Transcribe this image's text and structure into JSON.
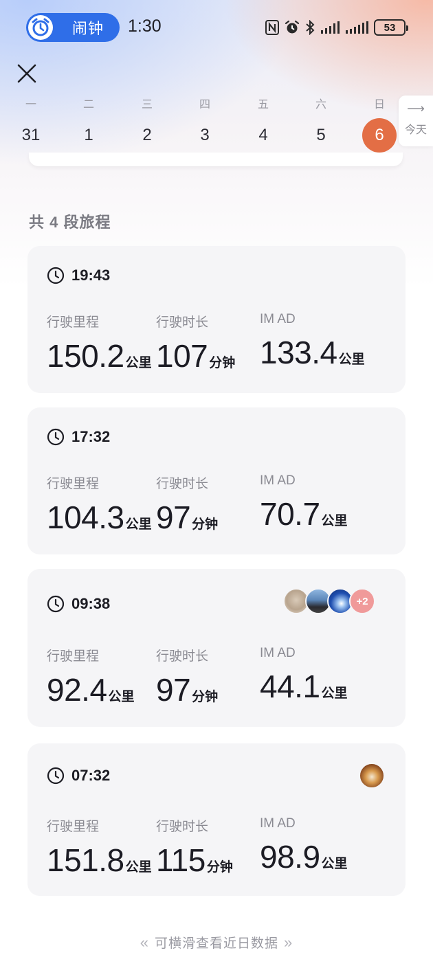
{
  "status_bar": {
    "pill_label": "闹钟",
    "time": "1:30",
    "battery": "53",
    "accent_color": "#2f6ee8"
  },
  "week": {
    "days": [
      {
        "dow": "一",
        "num": "31"
      },
      {
        "dow": "二",
        "num": "1"
      },
      {
        "dow": "三",
        "num": "2"
      },
      {
        "dow": "四",
        "num": "3"
      },
      {
        "dow": "五",
        "num": "4"
      },
      {
        "dow": "六",
        "num": "5"
      },
      {
        "dow": "日",
        "num": "6"
      }
    ],
    "selected_index": 6,
    "selected_color": "#e36e45",
    "today_label": "今天"
  },
  "trip_count_label": "共 4 段旅程",
  "metric_labels": {
    "distance": "行驶里程",
    "duration": "行驶时长",
    "imad": "IM AD"
  },
  "units": {
    "km": "公里",
    "min": "分钟"
  },
  "trips": [
    {
      "time": "19:43",
      "distance": "150.2",
      "duration": "107",
      "imad": "133.4"
    },
    {
      "time": "17:32",
      "distance": "104.3",
      "duration": "97",
      "imad": "70.7"
    },
    {
      "time": "09:38",
      "distance": "92.4",
      "duration": "97",
      "imad": "44.1",
      "avatar_more": "+2"
    },
    {
      "time": "07:32",
      "distance": "151.8",
      "duration": "115",
      "imad": "98.9"
    }
  ],
  "footer_hint": "可横滑查看近日数据",
  "icons": [
    "alarm-clock-icon",
    "close-icon",
    "clock-icon",
    "nfc-icon",
    "alarm-status-icon",
    "bluetooth-icon",
    "signal-icon",
    "battery-icon",
    "arrow-right-icon",
    "double-chevron-left-icon",
    "double-chevron-right-icon"
  ]
}
